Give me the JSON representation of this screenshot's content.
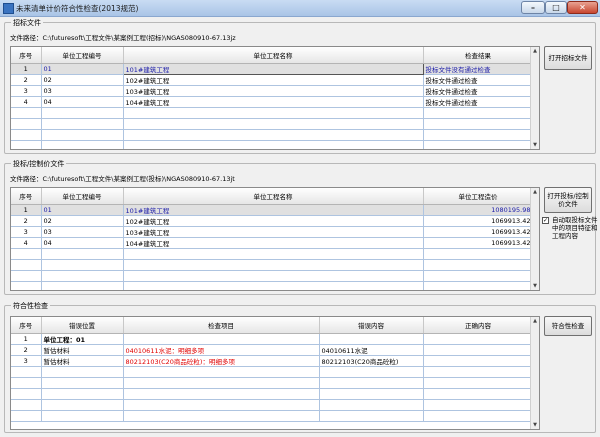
{
  "window": {
    "title": "未来清单计价符合性检查(2013规范)"
  },
  "sections": {
    "bid_file": {
      "title": "招标文件",
      "path_label": "文件路径：",
      "path": "C:\\futuresoft\\工程文件\\某案例工程(招标)\\NGAS080910-67.13jz",
      "columns": [
        "序号",
        "单位工程编号",
        "单位工程名称",
        "检查结果"
      ],
      "rows": [
        [
          "1",
          "01",
          "101#建筑工程",
          "投标文件没有通过检查"
        ],
        [
          "2",
          "02",
          "102#建筑工程",
          "投标文件通过检查"
        ],
        [
          "3",
          "03",
          "103#建筑工程",
          "投标文件通过检查"
        ],
        [
          "4",
          "04",
          "104#建筑工程",
          "投标文件通过检查"
        ]
      ],
      "button": "打开招标文件"
    },
    "tender_file": {
      "title": "投标/控制价文件",
      "path_label": "文件路径：",
      "path": "C:\\futuresoft\\工程文件\\某案例工程(投标)\\NGAS080910-67.13jt",
      "columns": [
        "序号",
        "单位工程编号",
        "单位工程名称",
        "单位工程造价"
      ],
      "rows": [
        [
          "1",
          "01",
          "101#建筑工程",
          "1080195.98"
        ],
        [
          "2",
          "02",
          "102#建筑工程",
          "1069913.42"
        ],
        [
          "3",
          "03",
          "103#建筑工程",
          "1069913.42"
        ],
        [
          "4",
          "04",
          "104#建筑工程",
          "1069913.42"
        ]
      ],
      "button": "打开投标/控制价文件",
      "checkbox": {
        "checked": true,
        "mark": "✓",
        "label": "自动取投标文件中的项目特征和工程内容"
      }
    },
    "compliance": {
      "title": "符合性检查",
      "columns": [
        "序号",
        "错误位置",
        "检查项目",
        "错误内容",
        "正确内容"
      ],
      "rows": [
        [
          "1",
          "单位工程：01",
          "",
          "",
          ""
        ],
        [
          "2",
          "暂估材料",
          "04010611水泥：明细多项",
          "04010611水泥",
          ""
        ],
        [
          "3",
          "暂估材料",
          "80212103(C20商品砼粒)：明细多项",
          "80212103(C20商品砼粒)",
          ""
        ]
      ],
      "button": "符合性检查"
    }
  },
  "icons": {
    "app": "app-icon",
    "min": "–",
    "max": "□",
    "close": "✕",
    "scroll_up": "▲",
    "scroll_down": "▼"
  }
}
